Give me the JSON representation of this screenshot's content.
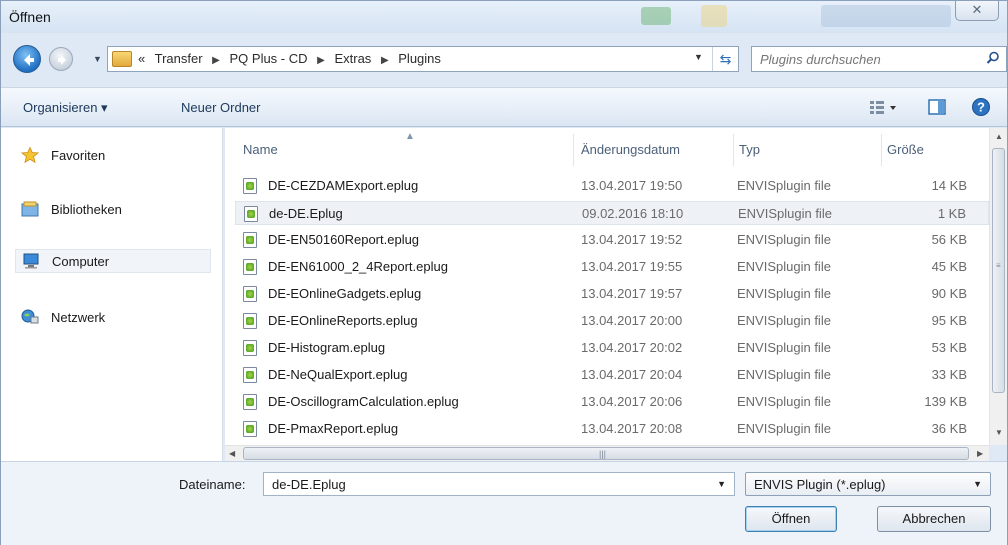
{
  "window": {
    "title": "Öffnen",
    "close_symbol": "✕"
  },
  "address": {
    "overflow": "«",
    "crumbs": [
      "Transfer",
      "PQ Plus - CD",
      "Extras",
      "Plugins"
    ],
    "separator": "▶",
    "search_placeholder": "Plugins durchsuchen"
  },
  "toolbar": {
    "organize_label": "Organisieren ▾",
    "new_folder_label": "Neuer Ordner",
    "icons": [
      "view-options-icon",
      "preview-pane-icon",
      "help-icon"
    ]
  },
  "navigation": {
    "items": [
      {
        "label": "Favoriten",
        "icon": "star-icon",
        "selected": false
      },
      {
        "label": "Bibliotheken",
        "icon": "libraries-icon",
        "selected": false
      },
      {
        "label": "Computer",
        "icon": "computer-icon",
        "selected": true
      },
      {
        "label": "Netzwerk",
        "icon": "network-icon",
        "selected": false
      }
    ]
  },
  "columns": {
    "name": "Name",
    "date": "Änderungsdatum",
    "type": "Typ",
    "size": "Größe"
  },
  "files": [
    {
      "name": "DE-CEZDAMExport.eplug",
      "date": "13.04.2017 19:50",
      "type": "ENVISplugin file",
      "size": "14 KB",
      "selected": false
    },
    {
      "name": "de-DE.Eplug",
      "date": "09.02.2016 18:10",
      "type": "ENVISplugin file",
      "size": "1 KB",
      "selected": true
    },
    {
      "name": "DE-EN50160Report.eplug",
      "date": "13.04.2017 19:52",
      "type": "ENVISplugin file",
      "size": "56 KB",
      "selected": false
    },
    {
      "name": "DE-EN61000_2_4Report.eplug",
      "date": "13.04.2017 19:55",
      "type": "ENVISplugin file",
      "size": "45 KB",
      "selected": false
    },
    {
      "name": "DE-EOnlineGadgets.eplug",
      "date": "13.04.2017 19:57",
      "type": "ENVISplugin file",
      "size": "90 KB",
      "selected": false
    },
    {
      "name": "DE-EOnlineReports.eplug",
      "date": "13.04.2017 20:00",
      "type": "ENVISplugin file",
      "size": "95 KB",
      "selected": false
    },
    {
      "name": "DE-Histogram.eplug",
      "date": "13.04.2017 20:02",
      "type": "ENVISplugin file",
      "size": "53 KB",
      "selected": false
    },
    {
      "name": "DE-NeQualExport.eplug",
      "date": "13.04.2017 20:04",
      "type": "ENVISplugin file",
      "size": "33 KB",
      "selected": false
    },
    {
      "name": "DE-OscillogramCalculation.eplug",
      "date": "13.04.2017 20:06",
      "type": "ENVISplugin file",
      "size": "139 KB",
      "selected": false
    },
    {
      "name": "DE-PmaxReport.eplug",
      "date": "13.04.2017 20:08",
      "type": "ENVISplugin file",
      "size": "36 KB",
      "selected": false
    }
  ],
  "bottom": {
    "filename_label": "Dateiname:",
    "filename_value": "de-DE.Eplug",
    "filter_value": "ENVIS Plugin (*.eplug)",
    "open_label": "Öffnen",
    "cancel_label": "Abbrechen"
  },
  "colors": {
    "window_bg": "#dfe9f5",
    "link_text": "#1e395b",
    "selected_row": "#eef2f7"
  }
}
